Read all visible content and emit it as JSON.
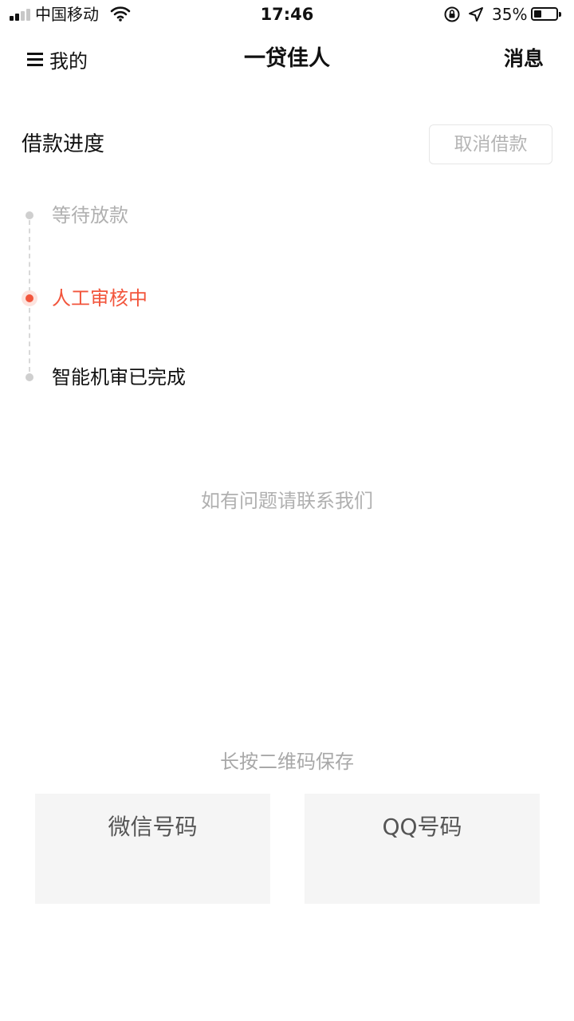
{
  "status_bar": {
    "carrier": "中国移动",
    "time": "17:46",
    "battery_percent": "35%",
    "battery_level": 0.35
  },
  "nav": {
    "left_label": "我的",
    "title": "一贷佳人",
    "right_label": "消息"
  },
  "progress": {
    "title": "借款进度",
    "cancel_label": "取消借款",
    "steps": [
      {
        "label": "等待放款",
        "state": "pending"
      },
      {
        "label": "人工审核中",
        "state": "active"
      },
      {
        "label": "智能机审已完成",
        "state": "done"
      }
    ]
  },
  "contact_note": "如有问题请联系我们",
  "qr": {
    "hint": "长按二维码保存",
    "wechat_label": "微信号码",
    "qq_label": "QQ号码"
  },
  "colors": {
    "accent": "#f2553c",
    "muted_text": "#b0b0b0",
    "card_bg": "#f5f5f5"
  }
}
